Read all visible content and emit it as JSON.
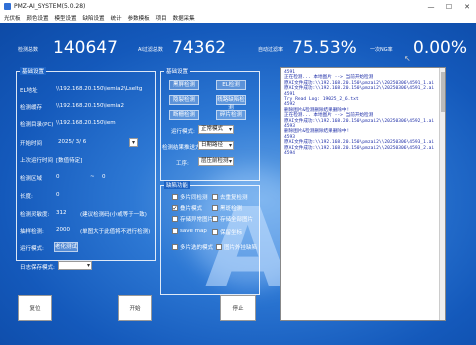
{
  "window": {
    "title": "PMZ-AI_SYSTEM(5.0.28)",
    "minimize": "—",
    "maximize": "☐",
    "close": "✕"
  },
  "menu": [
    "光伏板",
    "颜色设置",
    "模型设置",
    "缺陷设置",
    "统计",
    "参数模板",
    "项目",
    "数据采集"
  ],
  "stats": [
    {
      "label": "检测总数",
      "value": "140647"
    },
    {
      "label": "AI过滤总数",
      "value": "74362"
    },
    {
      "label": "自动过滤率",
      "value": "75.53%"
    },
    {
      "label": "一次NG率",
      "value": "0.00%"
    }
  ],
  "left": {
    "group_title": "基础设置",
    "ip1_label": "EL地址",
    "ip1_value": "\\\\192.168.20.150\\iemia2\\Lseltg",
    "ip2_label": "检测缓存",
    "ip2_value": "\\\\192.168.20.150\\iemia2",
    "ip3_label": "检测目录(PC)",
    "ip3_value": "\\\\192.168.20.150\\iem",
    "date_label": "开始时间",
    "date_value": "2025/ 3/ 6",
    "last_start_label": "上次运行时间",
    "last_start_value": "[数值待定]",
    "row_range_label": "检测区域",
    "row_range_value": "0",
    "row_range_tilde": "~",
    "row_range_end": "0",
    "rows_label": "长度:",
    "rows_value": "0",
    "sens_label": "检测灵敏度:",
    "sens_value": "312",
    "sens_hint": "(建议检测码(小或等于一致)",
    "count_label": "抽样检测:",
    "count_value": "2000",
    "count_hint": "(单图大于此值将不进行检测)",
    "fold_label": "运行模式:",
    "fold_value": "老化测试",
    "save_label": "日志保存模式:"
  },
  "mid": {
    "group_title": "基础设置",
    "checks": [
      "黑屏检测",
      "EL检测",
      "隐裂检测",
      "线路缺陷检测",
      "断栅检测",
      "碎片检测"
    ],
    "run_mode_label": "运行模式:",
    "run_mode_value": "正常模式",
    "save_mode_label": "检测结果推送方式:",
    "save_mode_value": "日期路径",
    "work_label": "工序:",
    "work_value": "层压前检测",
    "group2_title": "缺陷功能",
    "checks2": [
      {
        "label": "多片同检测",
        "checked": false
      },
      {
        "label": "去重复检测",
        "checked": false
      },
      {
        "label": "叠片模式",
        "checked": true
      },
      {
        "label": "黑斑检测",
        "checked": false
      },
      {
        "label": "存储异常图片",
        "checked": false
      },
      {
        "label": "存储全部图片",
        "checked": false
      },
      {
        "label": "save map",
        "checked": false
      },
      {
        "label": "保留坐标",
        "checked": false
      },
      {
        "label": "多片选的模式",
        "checked": false
      },
      {
        "label": "图片外挂缺陷",
        "checked": false
      }
    ]
  },
  "buttons": {
    "reset": "复位",
    "start": "开始",
    "stop": "停止"
  },
  "log": [
    "4591",
    "正在检测... 本地图片 --> 当前开始检测",
    "原AI文件成功:\\\\192.168.20.150\\pmzai2\\\\20250306\\4591_1.ai",
    "原AI文件成功:\\\\192.168.20.150\\pmzai2\\\\20250306\\4591_2.ai",
    "4591",
    "Try Read Log:  19025_2_6.txt",
    "4592",
    "删除图片&检测删除结果删除中!",
    "正在检测... 本地图片 --> 当前开始检测",
    "原AI文件成功:\\\\192.168.20.150\\pmzai2\\\\20250306\\4592_1.ai",
    "4593",
    "删除图片&检测删除结果删除中!",
    "4593",
    "原AI文件成功:\\\\192.168.20.150\\pmzai2\\\\20250306\\4593_1.ai",
    "原AI文件成功:\\\\192.168.20.150\\pmzai2\\\\20250306\\4593_2.ai",
    "4594"
  ],
  "decor": {
    "glyph": "Ai"
  }
}
